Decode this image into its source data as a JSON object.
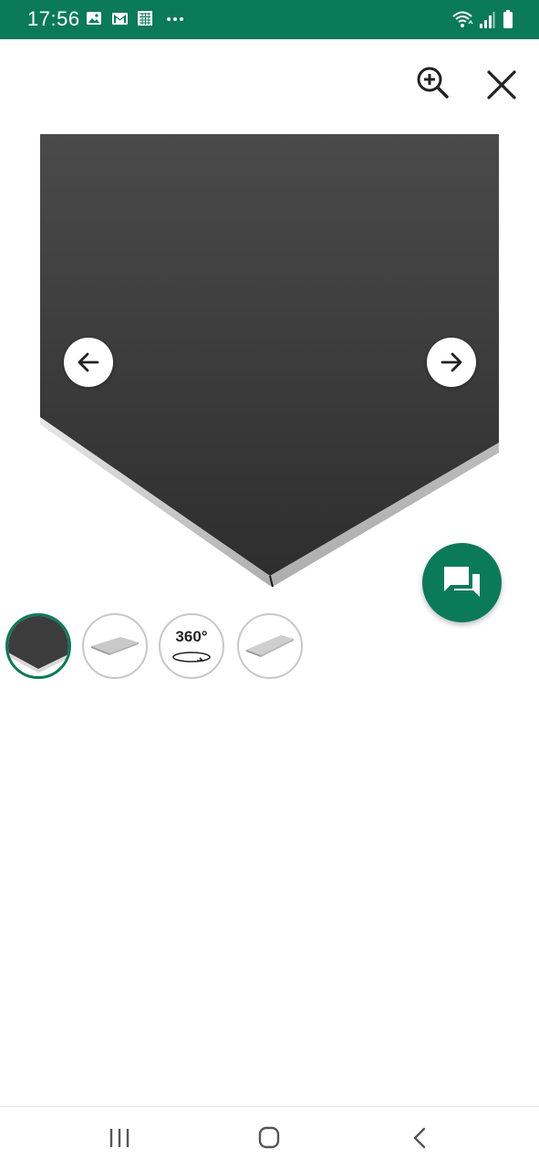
{
  "status_bar": {
    "time": "17:56",
    "notification_icons": [
      "image-icon",
      "gmail-icon",
      "calendar-app-icon",
      "more-dots-icon"
    ],
    "system_icons": [
      "wifi-icon",
      "signal-icon",
      "battery-icon"
    ]
  },
  "toolbar": {
    "zoom_icon": "zoom-in-icon",
    "close_icon": "close-icon"
  },
  "viewer": {
    "image": "product-panel-image",
    "prev_icon": "arrow-left-icon",
    "next_icon": "arrow-right-icon"
  },
  "chat_fab": {
    "icon": "chat-bubbles-icon"
  },
  "thumbnails": [
    {
      "kind": "photo",
      "active": true
    },
    {
      "kind": "photo",
      "active": false
    },
    {
      "kind": "360",
      "label": "360°",
      "active": false
    },
    {
      "kind": "photo",
      "active": false
    }
  ],
  "system_nav": {
    "icons": [
      "recent-apps-icon",
      "home-icon",
      "back-icon"
    ]
  },
  "colors": {
    "brand_green": "#0b7a59",
    "status_bar": "#0b7a59",
    "panel_dark": "#3e3e3e"
  }
}
